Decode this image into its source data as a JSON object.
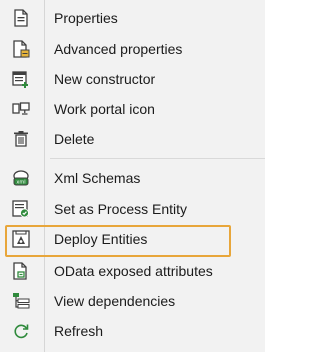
{
  "menu": {
    "items": [
      {
        "label": "Properties",
        "icon": "properties-icon"
      },
      {
        "label": "Advanced properties",
        "icon": "advanced-properties-icon"
      },
      {
        "label": "New constructor",
        "icon": "new-constructor-icon"
      },
      {
        "label": "Work portal icon",
        "icon": "work-portal-icon"
      },
      {
        "label": "Delete",
        "icon": "delete-icon"
      },
      {
        "label": "Xml Schemas",
        "icon": "xml-schemas-icon"
      },
      {
        "label": "Set as Process Entity",
        "icon": "process-entity-icon"
      },
      {
        "label": "Deploy Entities",
        "icon": "deploy-entities-icon"
      },
      {
        "label": "OData exposed attributes",
        "icon": "odata-icon"
      },
      {
        "label": "View dependencies",
        "icon": "view-dependencies-icon"
      },
      {
        "label": "Refresh",
        "icon": "refresh-icon"
      }
    ],
    "highlighted_item": "OData exposed attributes",
    "colors": {
      "highlight_border": "#e8a63a",
      "icon_dark": "#404040",
      "icon_green": "#2f8a3c"
    }
  }
}
